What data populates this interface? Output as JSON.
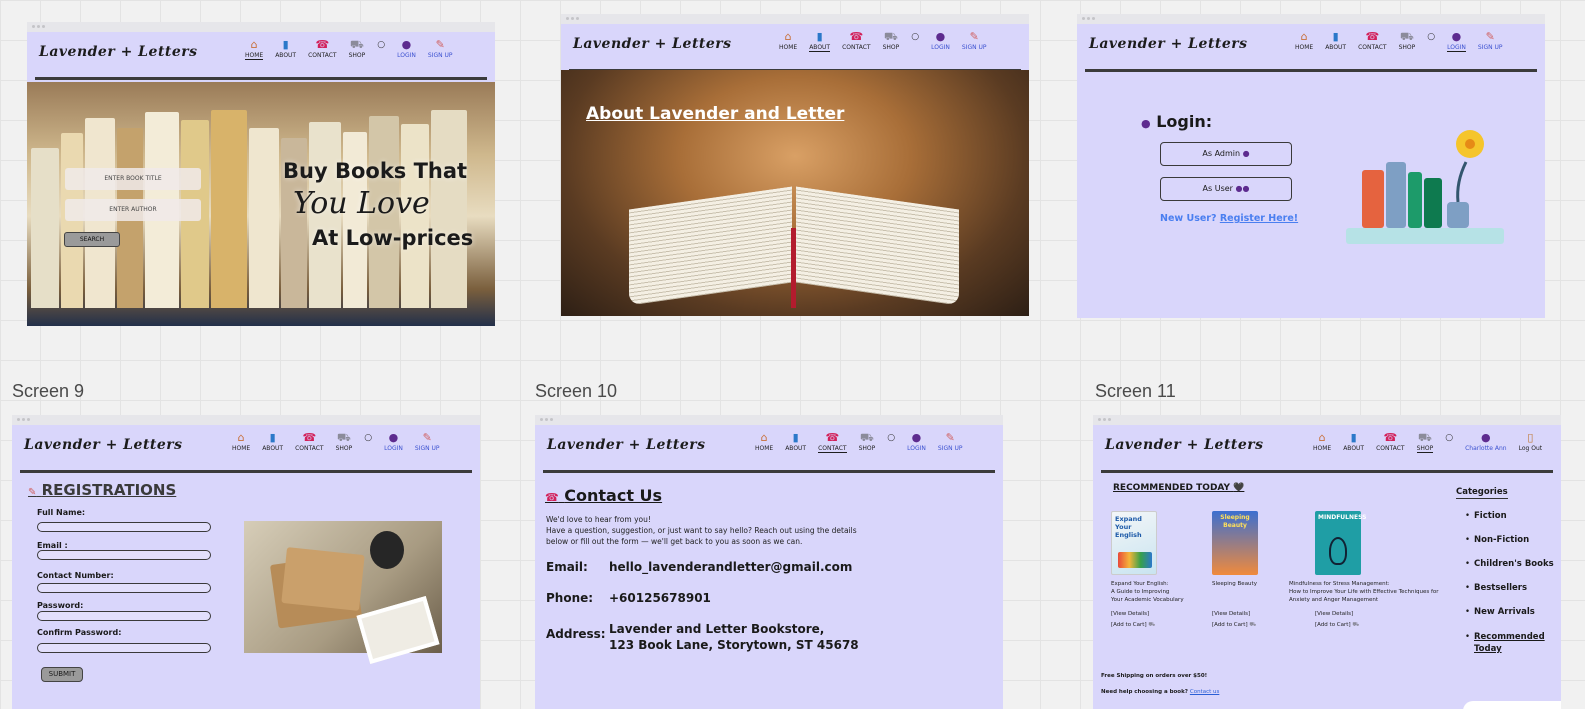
{
  "screen_labels": [
    "Screen 9",
    "Screen 10",
    "Screen 11"
  ],
  "brand": "Lavender + Letters",
  "nav": {
    "home": "HOME",
    "about": "ABOUT",
    "contact": "CONTACT",
    "shop": "SHOP",
    "login": "LOGIN",
    "signup": "SIGN UP",
    "user_name": "Charlotte Ann",
    "logout": "Log Out"
  },
  "icons": {
    "home": "house-icon",
    "about": "book-icon",
    "contact": "phone-icon",
    "shop": "cart-icon",
    "search": "search-icon",
    "login": "user-icon",
    "signup": "pen-icon",
    "logout": "door-icon"
  },
  "colors": {
    "frame_bg": "#d9d6fb",
    "accent_link": "#3c52d0",
    "rule": "#3b3b3b"
  },
  "home": {
    "title_placeholder": "ENTER BOOK TITLE",
    "author_placeholder": "ENTER AUTHOR",
    "search_btn": "SEARCH",
    "headline_1": "Buy Books That",
    "headline_2": "You Love",
    "headline_3": "At Low-prices"
  },
  "about": {
    "title": "About Lavender and Letter"
  },
  "login": {
    "title": "Login:",
    "as_admin": "As Admin",
    "as_user": "As User",
    "new_user": "New User?",
    "register": "Register Here!"
  },
  "registration": {
    "title": "REGISTRATIONS",
    "fields": [
      "Full Name:",
      "Email :",
      "Contact Number:",
      "Password:",
      "Confirm Password:"
    ],
    "submit": "SUBMIT"
  },
  "contact": {
    "title": "Contact Us",
    "intro_1": "We'd love to hear from you!",
    "intro_2": "Have a question, suggestion, or just want to say hello? Reach out using the details",
    "intro_3": "below or fill out the form — we'll get back to you as soon as we can.",
    "email_label": "Email:",
    "email": "hello_lavenderandletter@gmail.com",
    "phone_label": "Phone:",
    "phone": "+60125678901",
    "address_label": "Address:",
    "address_1": "Lavender and Letter Bookstore,",
    "address_2": "123 Book Lane, Storytown, ST 45678"
  },
  "shop": {
    "recommended": "RECOMMENDED TODAY",
    "heart": "🖤",
    "books": [
      {
        "cover_text": "Expand Your English",
        "title_1": "Expand Your English:",
        "title_2": "A Guide to Improving",
        "title_3": "Your Academic Vocabulary",
        "details": "[View Details]",
        "cart": "[Add to Cart]"
      },
      {
        "cover_text": "Sleeping Beauty",
        "title_1": "Sleeping Beauty",
        "title_2": "",
        "title_3": "",
        "details": "[View Details]",
        "cart": "[Add to Cart]"
      },
      {
        "cover_text": "MINDFULNESS",
        "title_1": "Mindfulness for Stress Management:",
        "title_2": "How to Improve Your Life with Effective Techniques for",
        "title_3": "Anxiety and Anger Management",
        "details": "[View Details]",
        "cart": "[Add to Cart]"
      }
    ],
    "categories_title": "Categories",
    "categories": [
      "Fiction",
      "Non-Fiction",
      "Children's Books",
      "Bestsellers",
      "New Arrivals",
      "Recommended",
      "Today"
    ],
    "free_shipping": "Free Shipping on orders over $50!",
    "help_text": "Need help choosing a book?",
    "help_link": "Contact us"
  }
}
